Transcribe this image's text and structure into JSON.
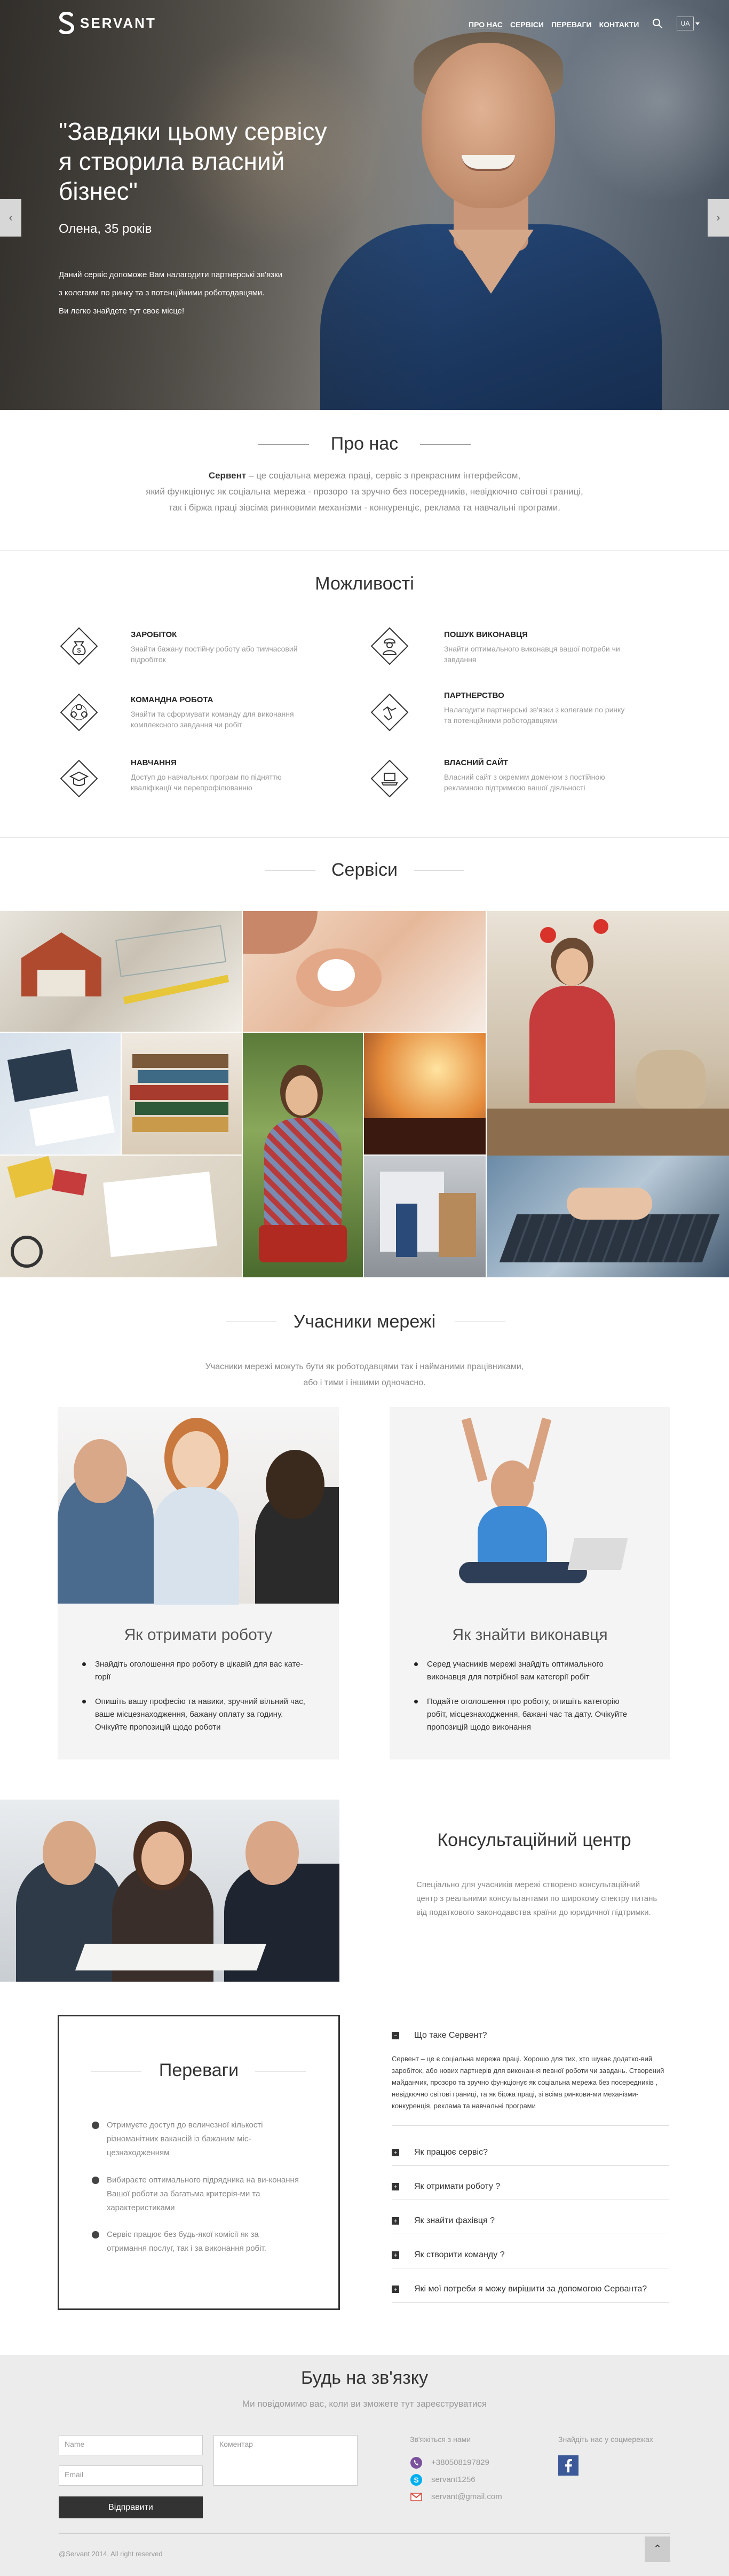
{
  "brand": {
    "name": "SERVANT"
  },
  "nav": {
    "items": [
      "ПРО НАС",
      "СЕРВІСИ",
      "ПЕРЕВАГИ",
      "КОНТАКТИ"
    ],
    "lang": "UA"
  },
  "hero": {
    "quote_1": "\"Завдяки цьому сервісу",
    "quote_2": "я створила власний",
    "quote_3": "бізнес\"",
    "author": "Олена, 35 років",
    "text_1": "Даний сервіс допоможе Вам налагодити партнерські зв'язки",
    "text_2": "з колегами по ринку та з потенційними роботодавцями.",
    "text_3": "Ви легко знайдете тут своє місце!",
    "prev": "‹",
    "next": "›"
  },
  "about": {
    "title": "Про нас",
    "line_1_bold": "Сервент",
    "line_1": " – це соціальна мережа праці, сервіс з прекрасним інтерфейсом,",
    "line_2": "який функціонує як соціальна мережа - прозоро та зручно без посередників, невідкючно світові границі,",
    "line_3": "так і біржа праці зівсіма ринковими механізми - конкуренціє, реклама та навчальні програми."
  },
  "features": {
    "title": "Можливості",
    "items": [
      {
        "icon": "money-bag-icon",
        "title": "ЗАРОБІТОК",
        "desc_1": "Знайти бажану постійну роботу або тимчасовий",
        "desc_2": "підробіток"
      },
      {
        "icon": "worker-icon",
        "title": "ПОШУК ВИКОНАВЦЯ",
        "desc_1": "Знайти оптимального виконавця вашої потреби чи",
        "desc_2": "завдання"
      },
      {
        "icon": "team-icon",
        "title": "КОМАНДНА РОБОТА",
        "desc_1": "Знайти та сформувати команду для виконання",
        "desc_2": "комплексного завдання чи робіт"
      },
      {
        "icon": "handshake-icon",
        "title": "ПАРТНЕРСТВО",
        "desc_1": "Налагодити партнерські зв'язки з колегами по ринку",
        "desc_2": "та потенційними роботодавцями"
      },
      {
        "icon": "graduation-cap-icon",
        "title": "НАВЧАННЯ",
        "desc_1": "Доступ до навчальних програм по підняттю",
        "desc_2": "кваліфікації чи перепрофілюванню"
      },
      {
        "icon": "laptop-icon",
        "title": "ВЛАСНИЙ САЙТ",
        "desc_1": "Власний сайт з окремим доменом з постійною",
        "desc_2": "рекламною підтримкою вашої діяльності"
      }
    ]
  },
  "services": {
    "title": "Сервіси"
  },
  "members": {
    "title": "Учасники мережі",
    "text_1": "Учасники мережі можуть бути як роботодавцями так і найманими працівниками,",
    "text_2": "або і тими і іншими одночасно.",
    "card_1": {
      "title": "Як отримати роботу",
      "li_1": "Знайдіть оголошення про роботу в цікавій для вас кате-горії",
      "li_2": "Опишіть вашу професію та навики, зручний вільний час, ваше місцезнаходження, бажану оплату за годину. Очікуйте пропозицій щодо роботи"
    },
    "card_2": {
      "title": "Як знайти виконавця",
      "li_1": "Серед учасників мережі знайдіть оптимального виконавця для потрібної вам категорії робіт",
      "li_2": "Подайте оголошення про роботу, опишіть категорію робіт, місцезнаходження, бажані час та дату. Очікуйте пропозицій щодо виконання"
    }
  },
  "consult": {
    "title": "Консультаційний центр",
    "text": "Спеціально для учасників мережі створено консультаційний центр з реальними консультантами по широкому спектру питань від податкового законодавства країни до юридичної підтримки."
  },
  "benefits": {
    "title": "Переваги",
    "items": [
      "Отримуєте доступ до величезної кількості різноманітних вакансій із бажаним міс-цезнаходженням",
      "Вибираєте оптимального підрядника на ви-конання Вашої роботи за багатьма критерія-ми та характеристиками",
      "Сервіс працює без будь-якої комісії як за отримання послуг, так і за виконання робіт."
    ]
  },
  "faq": {
    "open_q": "Що таке Сервент?",
    "open_a": "Сервент – це є соціальна мережа праці. Хорошо для тих, хто шукає додатко-вий заробіток, або нових партнерів для виконання певної роботи чи завдань. Створений майданчик, прозоро та зручно функціонує як соціальна мережа без посередників , невідкючно світові границі, та як біржа праці, зі всіма ринкови-ми механізми-конкуренція, реклама та навчальні програми",
    "items": [
      "Як працює сервіс?",
      "Як отримати роботу ?",
      "Як знайти фахівця ?",
      "Як створити команду ?",
      "Які мої потреби я можу вирішити за допомогою Серванта?"
    ]
  },
  "contact": {
    "title": "Будь на зв'язку",
    "subtitle": "Ми повідомимо вас, коли ви зможете тут зареєструватися",
    "name_ph": "Name",
    "email_ph": "Email",
    "comment_ph": "Коментар",
    "send": "Відправити",
    "reach_title": "Зв'яжіться з нами",
    "phone": "+380508197829",
    "skype": "servant1256",
    "email": "servant@gmail.com",
    "social_title": "Знайдіть нас у соцмережах",
    "copyright": "@Servant 2014. All right reserved",
    "up": "⌃"
  },
  "colors": {
    "dark": "#333333",
    "grey_text": "#888888",
    "footer_bg": "#ececec",
    "facebook": "#3b5998"
  }
}
